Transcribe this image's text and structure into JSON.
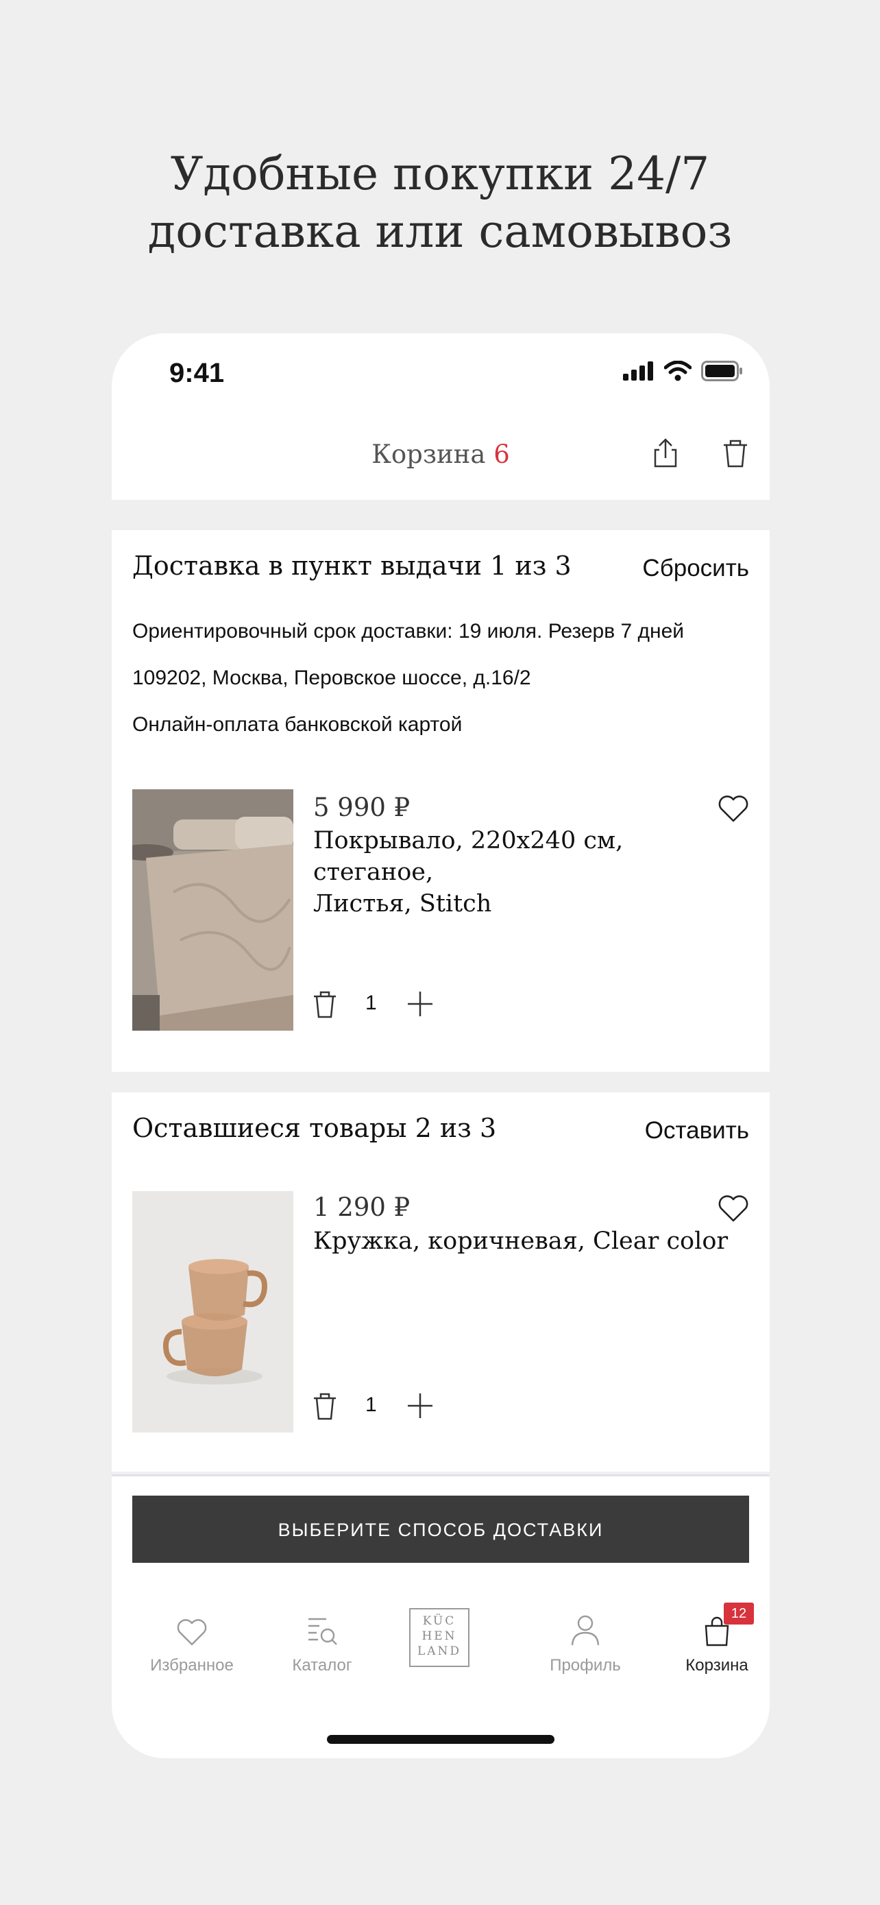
{
  "promo": {
    "line1": "Удобные покупки 24/7",
    "line2": "доставка или самовывоз"
  },
  "status_bar": {
    "time": "9:41"
  },
  "header": {
    "title": "Корзина",
    "count": "6",
    "share_icon": "share-icon",
    "trash_icon": "trash-icon"
  },
  "section1": {
    "title": "Доставка в пункт выдачи 1 из 3",
    "action": "Сбросить",
    "info": [
      "Ориентировочный срок доставки: 19 июля. Резерв 7 дней",
      "109202, Москва, Перовское шоссе, д.16/2",
      "Онлайн-оплата банковской картой"
    ],
    "item": {
      "price": "5 990 ₽",
      "name_line1": "Покрывало, 220х240 см, стеганое,",
      "name_line2": "Листья, Stitch",
      "qty": "1"
    }
  },
  "section2": {
    "title": "Оставшиеся товары 2 из 3",
    "action": "Оставить",
    "item": {
      "price": "1 290 ₽",
      "name": "Кружка, коричневая, Clear color",
      "qty": "1"
    }
  },
  "cta": {
    "label": "ВЫБЕРИТЕ СПОСОБ ДОСТАВКИ"
  },
  "tabbar": {
    "favorites": "Избранное",
    "catalog": "Каталог",
    "logo_line1": "KÜC",
    "logo_line2": "HEN",
    "logo_line3": "LAND",
    "profile": "Профиль",
    "cart": "Корзина",
    "cart_badge": "12"
  },
  "colors": {
    "accent": "#d8323c",
    "button": "#3b3b3b",
    "background": "#efefef"
  }
}
